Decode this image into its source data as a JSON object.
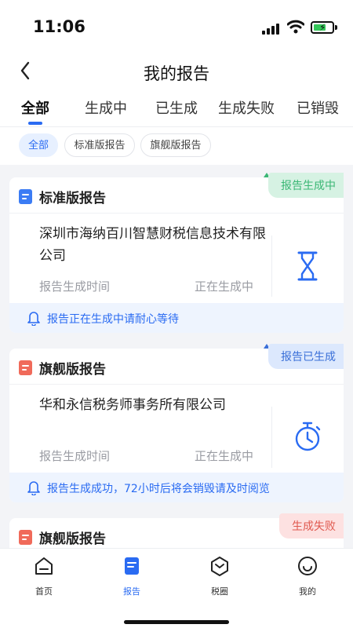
{
  "status_bar": {
    "time": "11:06"
  },
  "header": {
    "title": "我的报告"
  },
  "tabs": [
    {
      "label": "全部"
    },
    {
      "label": "生成中"
    },
    {
      "label": "已生成"
    },
    {
      "label": "生成失败"
    },
    {
      "label": "已销毁"
    }
  ],
  "filters": [
    {
      "label": "全部"
    },
    {
      "label": "标准版报告"
    },
    {
      "label": "旗舰版报告"
    }
  ],
  "cards": [
    {
      "title": "标准版报告",
      "badge": "报告生成中",
      "company": "深圳市海纳百川智慧财税信息技术有限公司",
      "time_label": "报告生成时间",
      "time_value": "正在生成中",
      "notice": "报告正在生成中请耐心等待"
    },
    {
      "title": "旗舰版报告",
      "badge": "报告已生成",
      "company": "华和永信税务师事务所有限公司",
      "time_label": "报告生成时间",
      "time_value": "正在生成中",
      "notice": "报告生成成功，72小时后将会销毁请及时阅览"
    },
    {
      "title": "旗舰版报告",
      "badge": "生成失败"
    }
  ],
  "bottom_nav": [
    {
      "label": "首页",
      "icon": "home-icon"
    },
    {
      "label": "报告",
      "icon": "report-icon"
    },
    {
      "label": "税圈",
      "icon": "circle-icon"
    },
    {
      "label": "我的",
      "icon": "profile-icon"
    }
  ],
  "colors": {
    "accent": "#2a6bf2",
    "success": "#3bb775",
    "danger": "#e0594f"
  }
}
